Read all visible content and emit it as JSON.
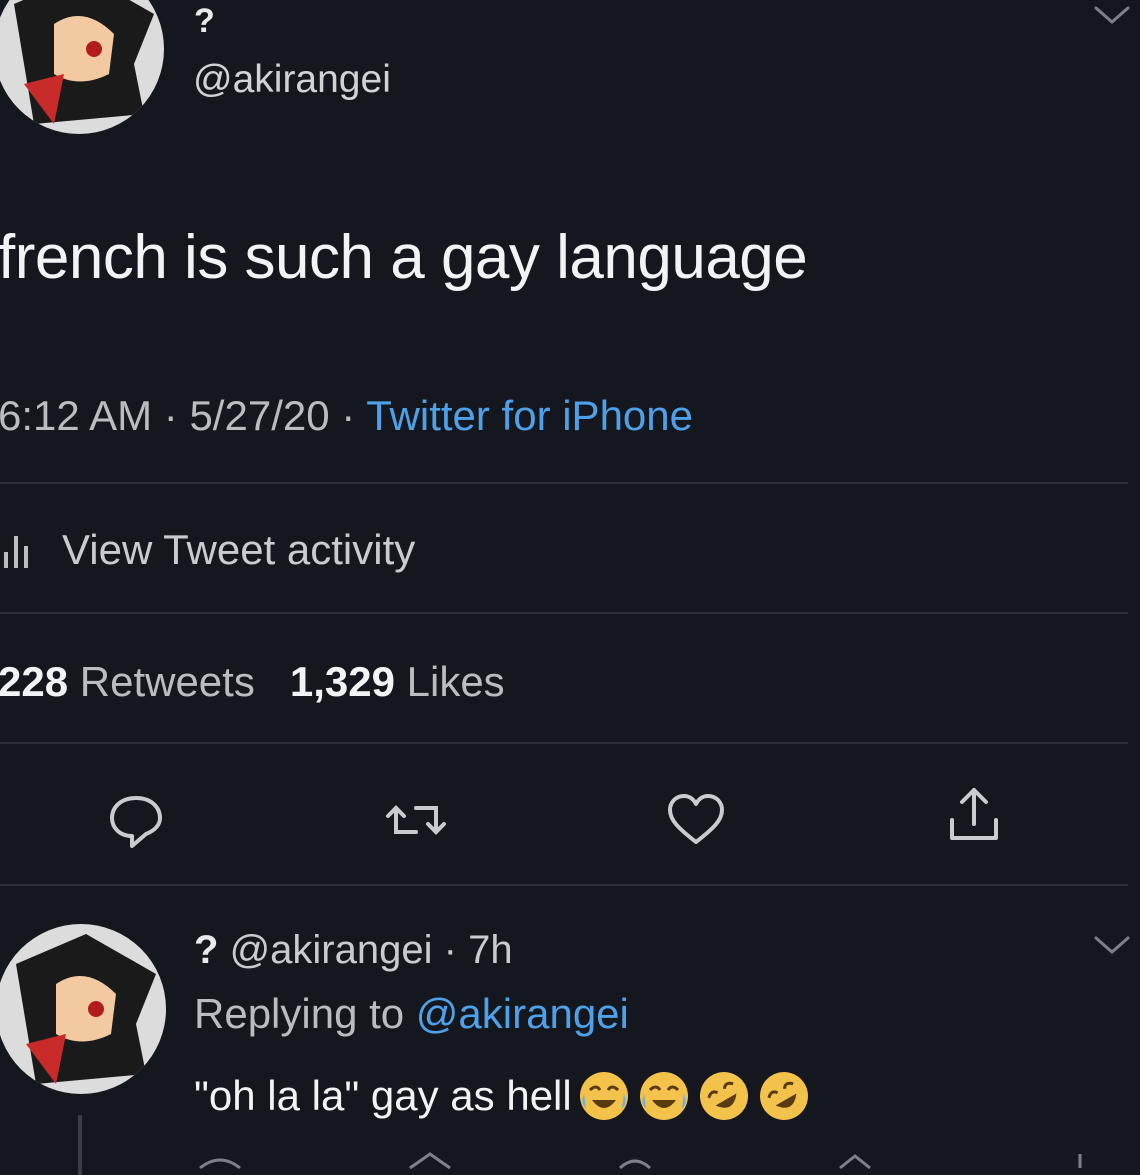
{
  "tweet": {
    "display_name": "?",
    "handle": "@akirangei",
    "text": "french is such a gay language",
    "time": "6:12 AM",
    "date": "5/27/20",
    "separator": "·",
    "source": "Twitter for iPhone",
    "activity_label": "View Tweet activity",
    "retweets_count": "228",
    "retweets_label": "Retweets",
    "likes_count": "1,329",
    "likes_label": "Likes"
  },
  "reply": {
    "display_name": "?",
    "handle": "@akirangei",
    "age": "7h",
    "separator": "·",
    "replying_label": "Replying to",
    "replying_to": "@akirangei",
    "text": "\"oh la la\" gay as hell",
    "emojis": [
      "crying-laughing-emoji",
      "crying-laughing-emoji",
      "rofl-emoji",
      "rofl-emoji"
    ]
  },
  "colors": {
    "background": "#15171e",
    "link_blue": "#4ea0e8",
    "text": "#f2f3f4",
    "muted": "#b9bcc0"
  }
}
